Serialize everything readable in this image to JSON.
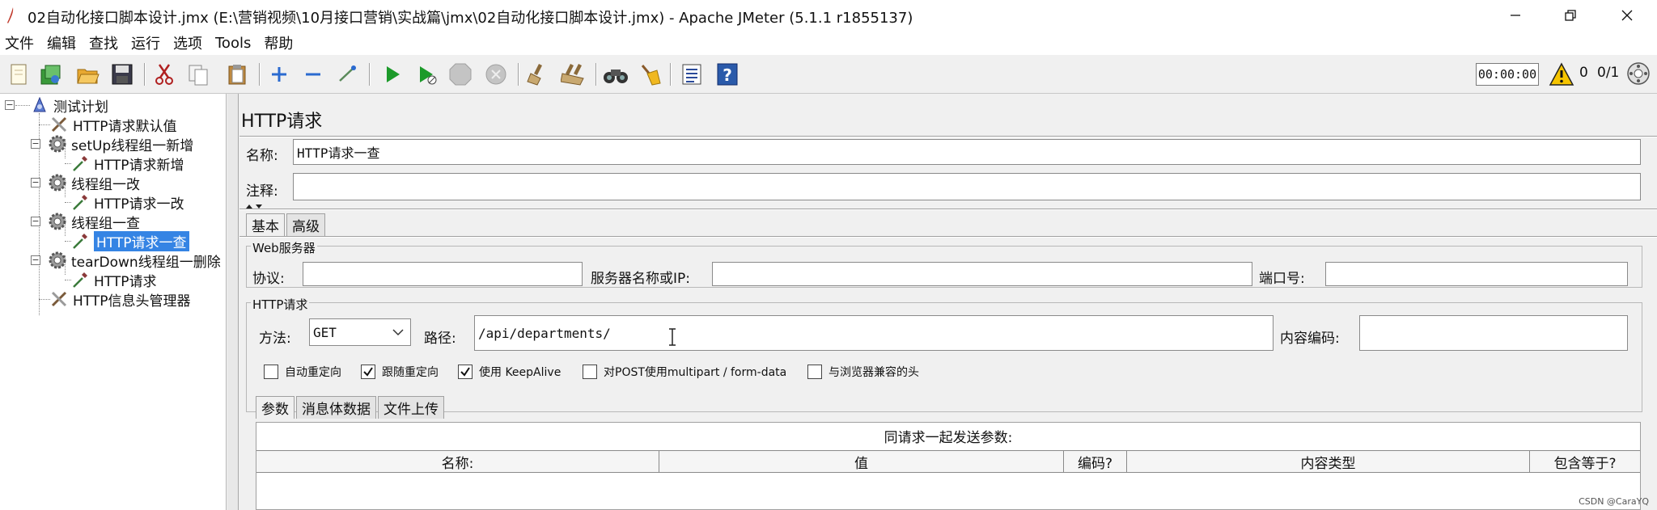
{
  "window": {
    "title": "02自动化接口脚本设计.jmx (E:\\营销视频\\10月接口营销\\实战篇\\jmx\\02自动化接口脚本设计.jmx) - Apache JMeter (5.1.1 r1855137)"
  },
  "menu": [
    "文件",
    "编辑",
    "查找",
    "运行",
    "选项",
    "Tools",
    "帮助"
  ],
  "toolbar": {
    "icons": [
      "new-icon",
      "templates-icon",
      "open-icon",
      "save-icon",
      "cut-icon",
      "copy-icon",
      "paste-icon",
      "expand-icon",
      "collapse-icon",
      "toggle-icon",
      "start-icon",
      "start-no-timers-icon",
      "stop-icon",
      "shutdown-icon",
      "clear-icon",
      "clear-all-icon",
      "search-icon",
      "reset-search-icon",
      "function-helper-icon",
      "help-icon"
    ],
    "timer": "00:00:00",
    "warning_count": "0",
    "thread_count": "0/1"
  },
  "tree": [
    {
      "label": "测试计划",
      "icon": "test-plan-icon",
      "level": 0,
      "toggle": "−"
    },
    {
      "label": "HTTP请求默认值",
      "icon": "config-element-icon",
      "level": 1
    },
    {
      "label": "setUp线程组一新增",
      "icon": "thread-group-icon",
      "level": 1,
      "toggle": "−"
    },
    {
      "label": "HTTP请求新增",
      "icon": "sampler-icon",
      "level": 2
    },
    {
      "label": "线程组一改",
      "icon": "thread-group-icon",
      "level": 1,
      "toggle": "−"
    },
    {
      "label": "HTTP请求一改",
      "icon": "sampler-icon",
      "level": 2
    },
    {
      "label": "线程组一查",
      "icon": "thread-group-icon",
      "level": 1,
      "toggle": "−"
    },
    {
      "label": "HTTP请求一查",
      "icon": "sampler-icon",
      "level": 2,
      "selected": true
    },
    {
      "label": "tearDown线程组一删除",
      "icon": "thread-group-icon",
      "level": 1,
      "toggle": "−"
    },
    {
      "label": "HTTP请求",
      "icon": "sampler-icon",
      "level": 2
    },
    {
      "label": "HTTP信息头管理器",
      "icon": "config-element-icon",
      "level": 1
    }
  ],
  "panel": {
    "title": "HTTP请求",
    "name_label": "名称:",
    "name_value": "HTTP请求一查",
    "comment_label": "注释:",
    "comment_value": "",
    "tabs": [
      "基本",
      "高级"
    ],
    "web_server": {
      "group_title": "Web服务器",
      "protocol_label": "协议:",
      "protocol_value": "",
      "server_label": "服务器名称或IP:",
      "server_value": "",
      "port_label": "端口号:",
      "port_value": ""
    },
    "http_request": {
      "group_title": "HTTP请求",
      "method_label": "方法:",
      "method_value": "GET",
      "path_label": "路径:",
      "path_value": "/api/departments/",
      "encoding_label": "内容编码:",
      "encoding_value": ""
    },
    "checkboxes": [
      {
        "label": "自动重定向",
        "checked": false
      },
      {
        "label": "跟随重定向",
        "checked": true
      },
      {
        "label": "使用 KeepAlive",
        "checked": true
      },
      {
        "label": "对POST使用multipart / form-data",
        "checked": false
      },
      {
        "label": "与浏览器兼容的头",
        "checked": false
      }
    ],
    "param_tabs": [
      "参数",
      "消息体数据",
      "文件上传"
    ],
    "params_caption": "同请求一起发送参数:",
    "params_columns": [
      "名称:",
      "值",
      "编码?",
      "内容类型",
      "包含等于?"
    ]
  },
  "watermark": "CSDN @CaraYQ"
}
